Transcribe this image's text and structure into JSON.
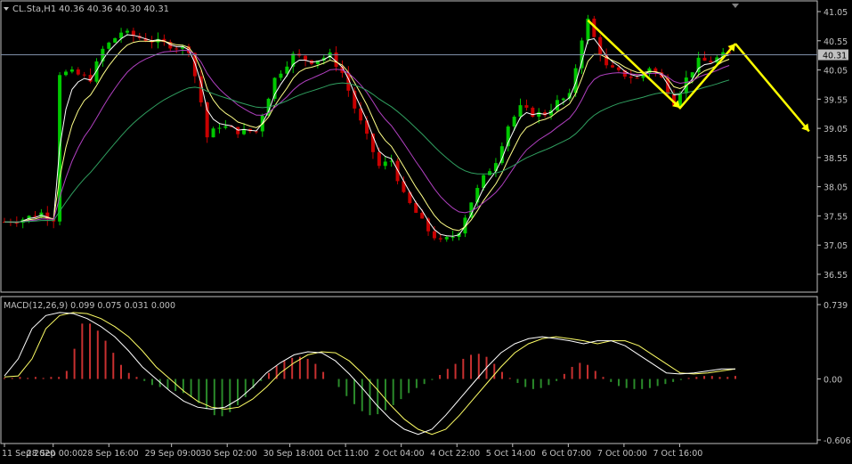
{
  "header": {
    "symbol_label": "CL.Sta,H1",
    "ohlc": "40.36 40.36 40.30 40.31"
  },
  "price_scale": {
    "ticks": [
      "41.05",
      "40.55",
      "40.05",
      "39.55",
      "39.05",
      "38.55",
      "38.05",
      "37.55",
      "37.05",
      "36.55"
    ],
    "current_price": "40.31"
  },
  "macd": {
    "label": "MACD(12,26,9) 0.099 0.075 0.031 0.000",
    "ticks": [
      "0.739",
      "0.00",
      "-0.606"
    ]
  },
  "time_axis": {
    "labels": [
      "11 Sep 2020",
      "28 Sep 00:00",
      "28 Sep 16:00",
      "29 Sep 09:00",
      "30 Sep 02:00",
      "30 Sep 18:00",
      "1 Oct 11:00",
      "2 Oct 04:00",
      "4 Oct 22:00",
      "5 Oct 14:00",
      "6 Oct 07:00",
      "7 Oct 00:00",
      "7 Oct 16:00"
    ]
  },
  "colors": {
    "background": "#000000",
    "bull": "#00c800",
    "bear": "#c80000",
    "ma_fast": "#ffffff",
    "ma_mid": "#ffff88",
    "ma_slow": "#b040c0",
    "ma_long": "#30a060",
    "arrow": "#ffff00",
    "macd_pos": "#c83030",
    "macd_neg": "#2a8a2a",
    "signal": "#ffff66",
    "grid_axis": "#c0c0c0"
  },
  "chart_data": [
    {
      "type": "candlestick",
      "title": "CL.Sta,H1",
      "ylim": [
        36.55,
        41.05
      ],
      "x_tick_labels": [
        "11 Sep 2020",
        "28 Sep 00:00",
        "28 Sep 16:00",
        "29 Sep 09:00",
        "30 Sep 02:00",
        "30 Sep 18:00",
        "1 Oct 11:00",
        "2 Oct 04:00",
        "4 Oct 22:00",
        "5 Oct 14:00",
        "6 Oct 07:00",
        "7 Oct 00:00",
        "7 Oct 16:00"
      ],
      "close_path": [
        [
          0,
          37.45
        ],
        [
          3,
          37.5
        ],
        [
          6,
          37.6
        ],
        [
          8,
          37.5
        ],
        [
          9,
          40.0
        ],
        [
          11,
          40.0
        ],
        [
          14,
          39.9
        ],
        [
          16,
          40.4
        ],
        [
          19,
          40.7
        ],
        [
          22,
          40.6
        ],
        [
          26,
          40.5
        ],
        [
          30,
          40.4
        ],
        [
          32,
          39.5
        ],
        [
          33,
          38.9
        ],
        [
          35,
          39.1
        ],
        [
          38,
          39.0
        ],
        [
          41,
          39.0
        ],
        [
          44,
          39.9
        ],
        [
          47,
          40.3
        ],
        [
          50,
          40.2
        ],
        [
          53,
          40.3
        ],
        [
          55,
          40.0
        ],
        [
          57,
          39.4
        ],
        [
          59,
          38.9
        ],
        [
          61,
          38.4
        ],
        [
          63,
          38.5
        ],
        [
          65,
          37.9
        ],
        [
          67,
          37.6
        ],
        [
          69,
          37.3
        ],
        [
          71,
          37.1
        ],
        [
          73,
          37.2
        ],
        [
          74,
          37.3
        ],
        [
          76,
          37.8
        ],
        [
          78,
          38.2
        ],
        [
          80,
          38.5
        ],
        [
          82,
          39.1
        ],
        [
          84,
          39.4
        ],
        [
          86,
          39.3
        ],
        [
          88,
          39.3
        ],
        [
          90,
          39.5
        ],
        [
          92,
          39.6
        ],
        [
          94,
          40.6
        ],
        [
          95,
          40.9
        ],
        [
          96,
          40.6
        ],
        [
          98,
          40.1
        ],
        [
          100,
          40.0
        ],
        [
          103,
          39.9
        ],
        [
          105,
          40.1
        ],
        [
          107,
          39.9
        ],
        [
          109,
          39.5
        ],
        [
          111,
          39.9
        ],
        [
          113,
          40.2
        ],
        [
          115,
          40.2
        ],
        [
          117,
          40.3
        ],
        [
          118,
          40.31
        ]
      ],
      "current_price": 40.31,
      "moving_averages": [
        "fast",
        "mid",
        "slow",
        "long"
      ]
    },
    {
      "type": "histogram",
      "title": "MACD(12,26,9) 0.099 0.075 0.031 0.000",
      "ylim": [
        -0.606,
        0.739
      ],
      "series": [
        {
          "name": "MACD",
          "values": [
            0.01,
            0.01,
            0.02,
            0.01,
            0.02,
            0.01,
            0.02,
            0.02,
            0.08,
            0.3,
            0.55,
            0.55,
            0.48,
            0.38,
            0.26,
            0.14,
            0.06,
            0.02,
            -0.02,
            -0.06,
            -0.08,
            -0.1,
            -0.12,
            -0.14,
            -0.18,
            -0.24,
            -0.3,
            -0.36,
            -0.37,
            -0.33,
            -0.26,
            -0.18,
            -0.09,
            -0.02,
            0.06,
            0.13,
            0.18,
            0.21,
            0.22,
            0.2,
            0.15,
            0.07,
            0.0,
            -0.08,
            -0.17,
            -0.25,
            -0.32,
            -0.36,
            -0.35,
            -0.31,
            -0.26,
            -0.2,
            -0.14,
            -0.09,
            -0.05,
            -0.01,
            0.04,
            0.1,
            0.15,
            0.2,
            0.24,
            0.25,
            0.22,
            0.15,
            0.07,
            0.01,
            -0.04,
            -0.08,
            -0.1,
            -0.09,
            -0.06,
            -0.02,
            0.05,
            0.12,
            0.16,
            0.14,
            0.08,
            0.02,
            -0.03,
            -0.07,
            -0.09,
            -0.1,
            -0.1,
            -0.09,
            -0.07,
            -0.05,
            -0.03,
            -0.01,
            0.01,
            0.02,
            0.03,
            0.03,
            0.02,
            0.02,
            0.03
          ]
        },
        {
          "name": "Signal",
          "values": [
            0.02,
            0.03,
            0.2,
            0.5,
            0.63,
            0.66,
            0.65,
            0.6,
            0.52,
            0.42,
            0.28,
            0.12,
            0.0,
            -0.12,
            -0.22,
            -0.28,
            -0.3,
            -0.28,
            -0.2,
            -0.08,
            0.06,
            0.16,
            0.24,
            0.27,
            0.26,
            0.18,
            0.05,
            -0.1,
            -0.26,
            -0.4,
            -0.5,
            -0.55,
            -0.5,
            -0.36,
            -0.2,
            -0.04,
            0.12,
            0.26,
            0.35,
            0.4,
            0.42,
            0.4,
            0.38,
            0.35,
            0.38,
            0.38,
            0.33,
            0.24,
            0.15,
            0.06,
            0.05,
            0.06,
            0.08,
            0.1
          ]
        }
      ]
    }
  ]
}
